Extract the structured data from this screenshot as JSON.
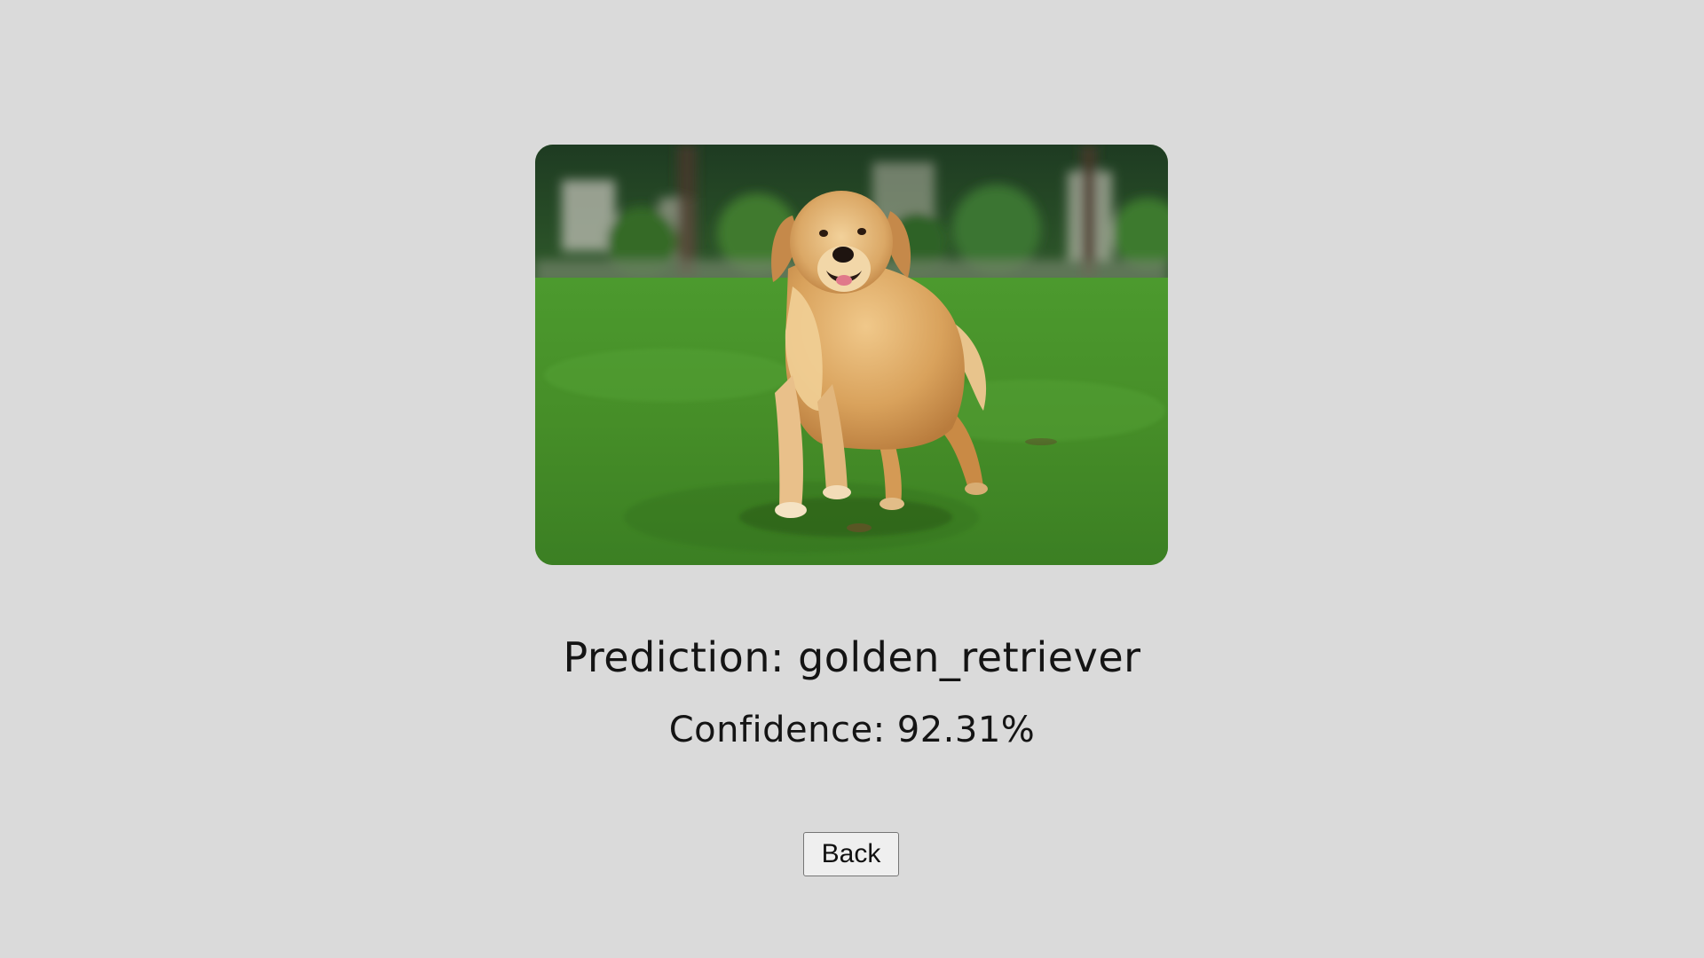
{
  "result": {
    "photo_subject": "golden-retriever-on-grass",
    "prediction_text": "Prediction: golden_retriever",
    "confidence_text": "Confidence: 92.31%"
  },
  "actions": {
    "back_label": "Back"
  },
  "colors": {
    "background": "#dadada",
    "text": "#141414",
    "button_bg": "#efefef",
    "button_border": "#767676"
  }
}
